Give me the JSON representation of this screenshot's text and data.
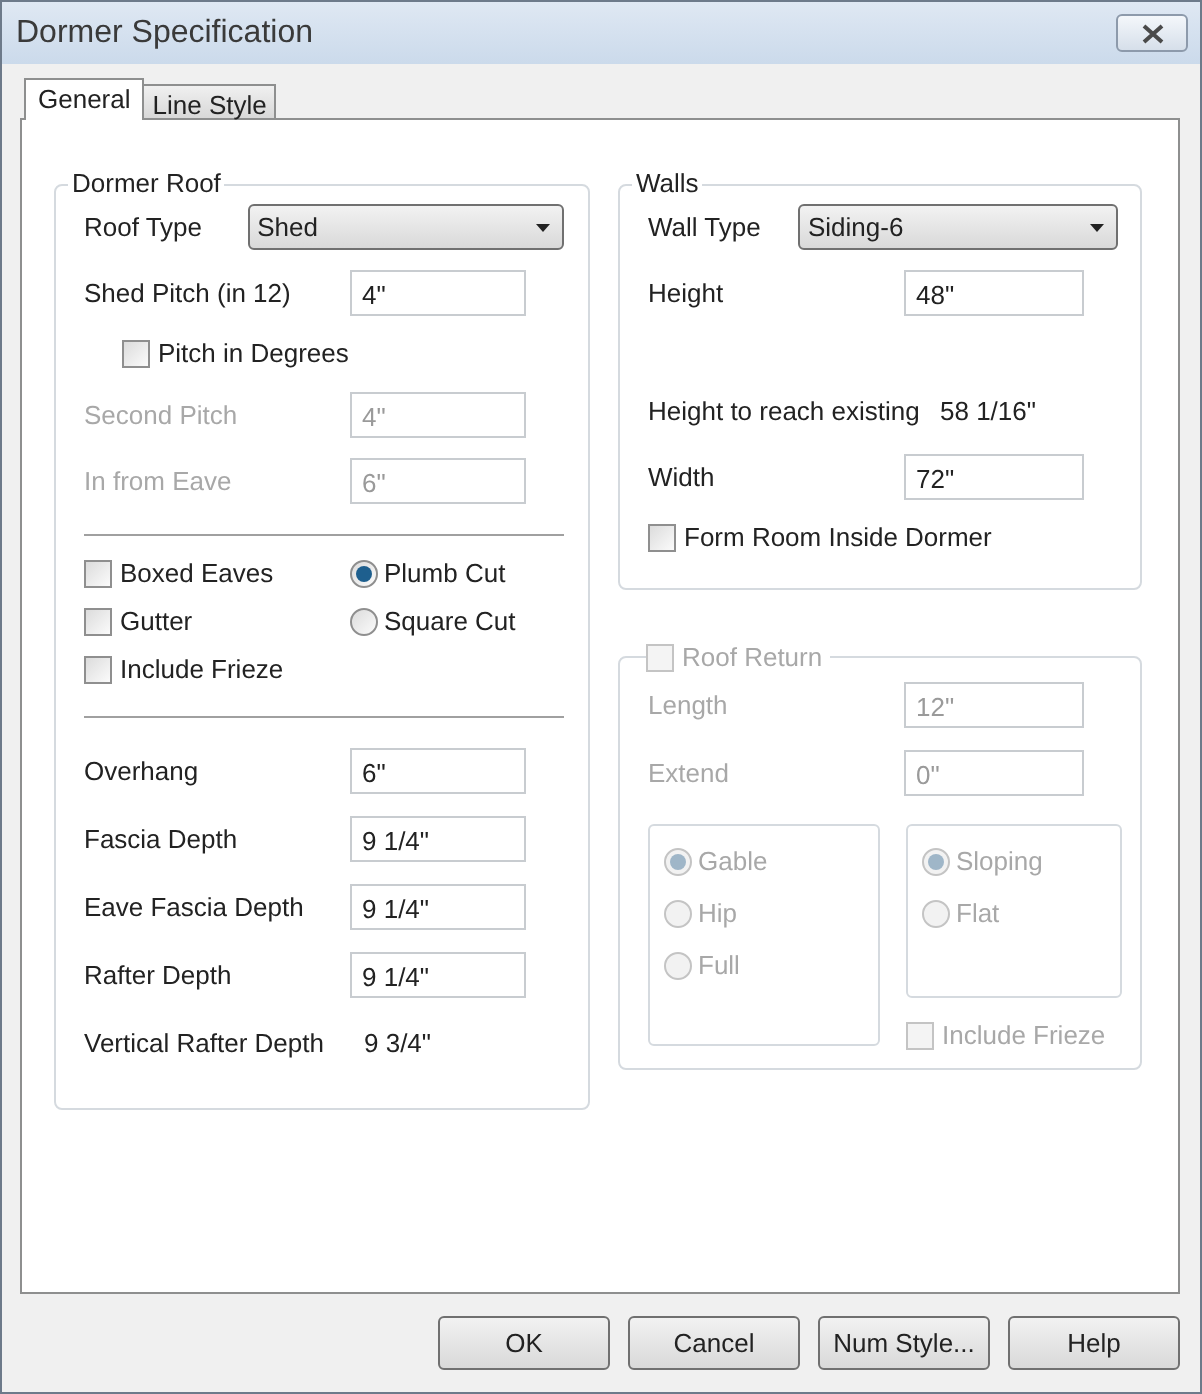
{
  "window": {
    "title": "Dormer Specification"
  },
  "tabs": [
    {
      "label": "General",
      "selected": true
    },
    {
      "label": "Line Style",
      "selected": false
    }
  ],
  "dormer_roof": {
    "title": "Dormer Roof",
    "top_rows": [
      {
        "kind": "dropdown",
        "label": "Roof Type",
        "value": "Shed"
      },
      {
        "kind": "field",
        "label": "Shed Pitch (in 12)",
        "value": "4\"",
        "disabled": false
      },
      {
        "kind": "checkbox",
        "label": "Pitch in Degrees",
        "checked": false,
        "disabled": false
      },
      {
        "kind": "field",
        "label": "Second Pitch",
        "value": "4\"",
        "disabled": true
      },
      {
        "kind": "field",
        "label": "In from Eave",
        "value": "6\"",
        "disabled": true
      }
    ],
    "checkboxes": [
      {
        "label": "Boxed Eaves",
        "checked": false
      },
      {
        "label": "Gutter",
        "checked": false
      },
      {
        "label": "Include Frieze",
        "checked": false
      }
    ],
    "radios": [
      {
        "label": "Plumb Cut",
        "selected": true
      },
      {
        "label": "Square Cut",
        "selected": false
      }
    ],
    "bottom_rows": [
      {
        "kind": "field",
        "label": "Overhang",
        "value": "6\"",
        "disabled": false
      },
      {
        "kind": "field",
        "label": "Fascia Depth",
        "value": "9 1/4\"",
        "disabled": false
      },
      {
        "kind": "field",
        "label": "Eave Fascia Depth",
        "value": "9 1/4\"",
        "disabled": false
      },
      {
        "kind": "field",
        "label": "Rafter Depth",
        "value": "9 1/4\"",
        "disabled": false
      },
      {
        "kind": "readout",
        "label": "Vertical Rafter Depth",
        "value": "9 3/4\""
      }
    ]
  },
  "walls": {
    "title": "Walls",
    "rows": [
      {
        "kind": "dropdown",
        "label": "Wall Type",
        "value": "Siding-6"
      },
      {
        "kind": "field",
        "label": "Height",
        "value": "48\"",
        "disabled": false
      },
      {
        "kind": "readout",
        "label": "Height to reach existing",
        "value": "58 1/16\""
      },
      {
        "kind": "field",
        "label": "Width",
        "value": "72\"",
        "disabled": false
      },
      {
        "kind": "checkbox",
        "label": "Form Room Inside Dormer",
        "checked": false,
        "disabled": false
      }
    ]
  },
  "roof_return": {
    "title": "Roof Return",
    "checked": false,
    "disabled": true,
    "rows": [
      {
        "kind": "field",
        "label": "Length",
        "value": "12\"",
        "disabled": true
      },
      {
        "kind": "field",
        "label": "Extend",
        "value": "0\"",
        "disabled": true
      }
    ],
    "radio_groups": [
      [
        {
          "label": "Gable",
          "selected": true,
          "disabled": true
        },
        {
          "label": "Hip",
          "selected": false,
          "disabled": true
        },
        {
          "label": "Full",
          "selected": false,
          "disabled": true
        }
      ],
      [
        {
          "label": "Sloping",
          "selected": true,
          "disabled": true
        },
        {
          "label": "Flat",
          "selected": false,
          "disabled": true
        }
      ]
    ],
    "include_frieze": {
      "label": "Include Frieze",
      "checked": false,
      "disabled": true
    }
  },
  "buttons": [
    "OK",
    "Cancel",
    "Num Style...",
    "Help"
  ]
}
